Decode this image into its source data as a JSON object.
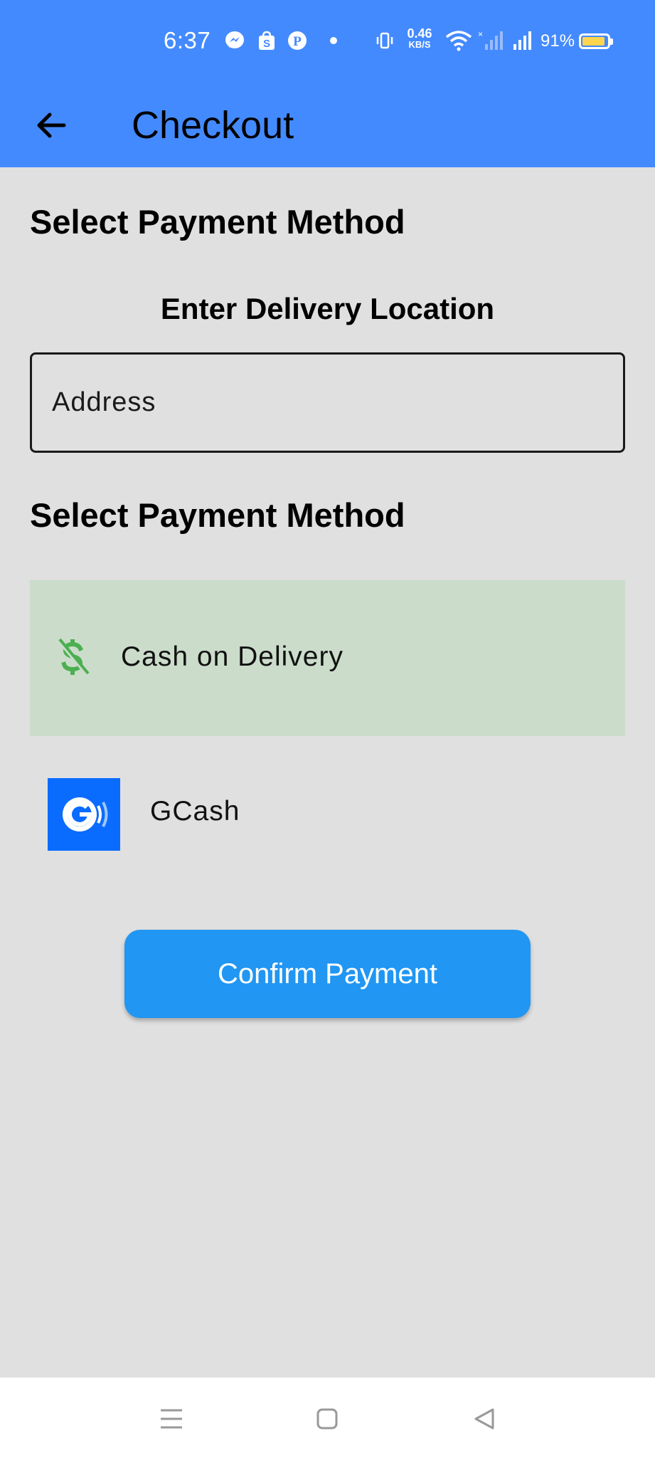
{
  "status_bar": {
    "time": "6:37",
    "net_speed_value": "0.46",
    "net_speed_unit": "KB/S",
    "battery_percent": "91%",
    "battery_level": 0.91,
    "icons": [
      "messenger-icon",
      "shopee-icon",
      "pinterest-icon",
      "dot-icon",
      "vibrate-icon",
      "wifi-icon",
      "signal-icon",
      "battery-icon"
    ]
  },
  "app_bar": {
    "back_icon": "arrow-left-icon",
    "title": "Checkout",
    "color": "#448aff"
  },
  "main": {
    "heading_top": "Select Payment Method",
    "delivery_title": "Enter Delivery Location",
    "address_placeholder": "Address",
    "payment_heading": "Select Payment Method",
    "payment_options": [
      {
        "label": "Cash on Delivery",
        "icon": "dollar-icon",
        "selected": true
      },
      {
        "label": "GCash",
        "icon": "gcash-logo",
        "selected": false
      }
    ],
    "selected_color": "#cbdccb",
    "confirm_label": "Confirm Payment",
    "confirm_color": "#2196f3"
  },
  "nav_bar": {
    "icons": [
      "menu-icon",
      "home-icon",
      "back-icon"
    ]
  }
}
